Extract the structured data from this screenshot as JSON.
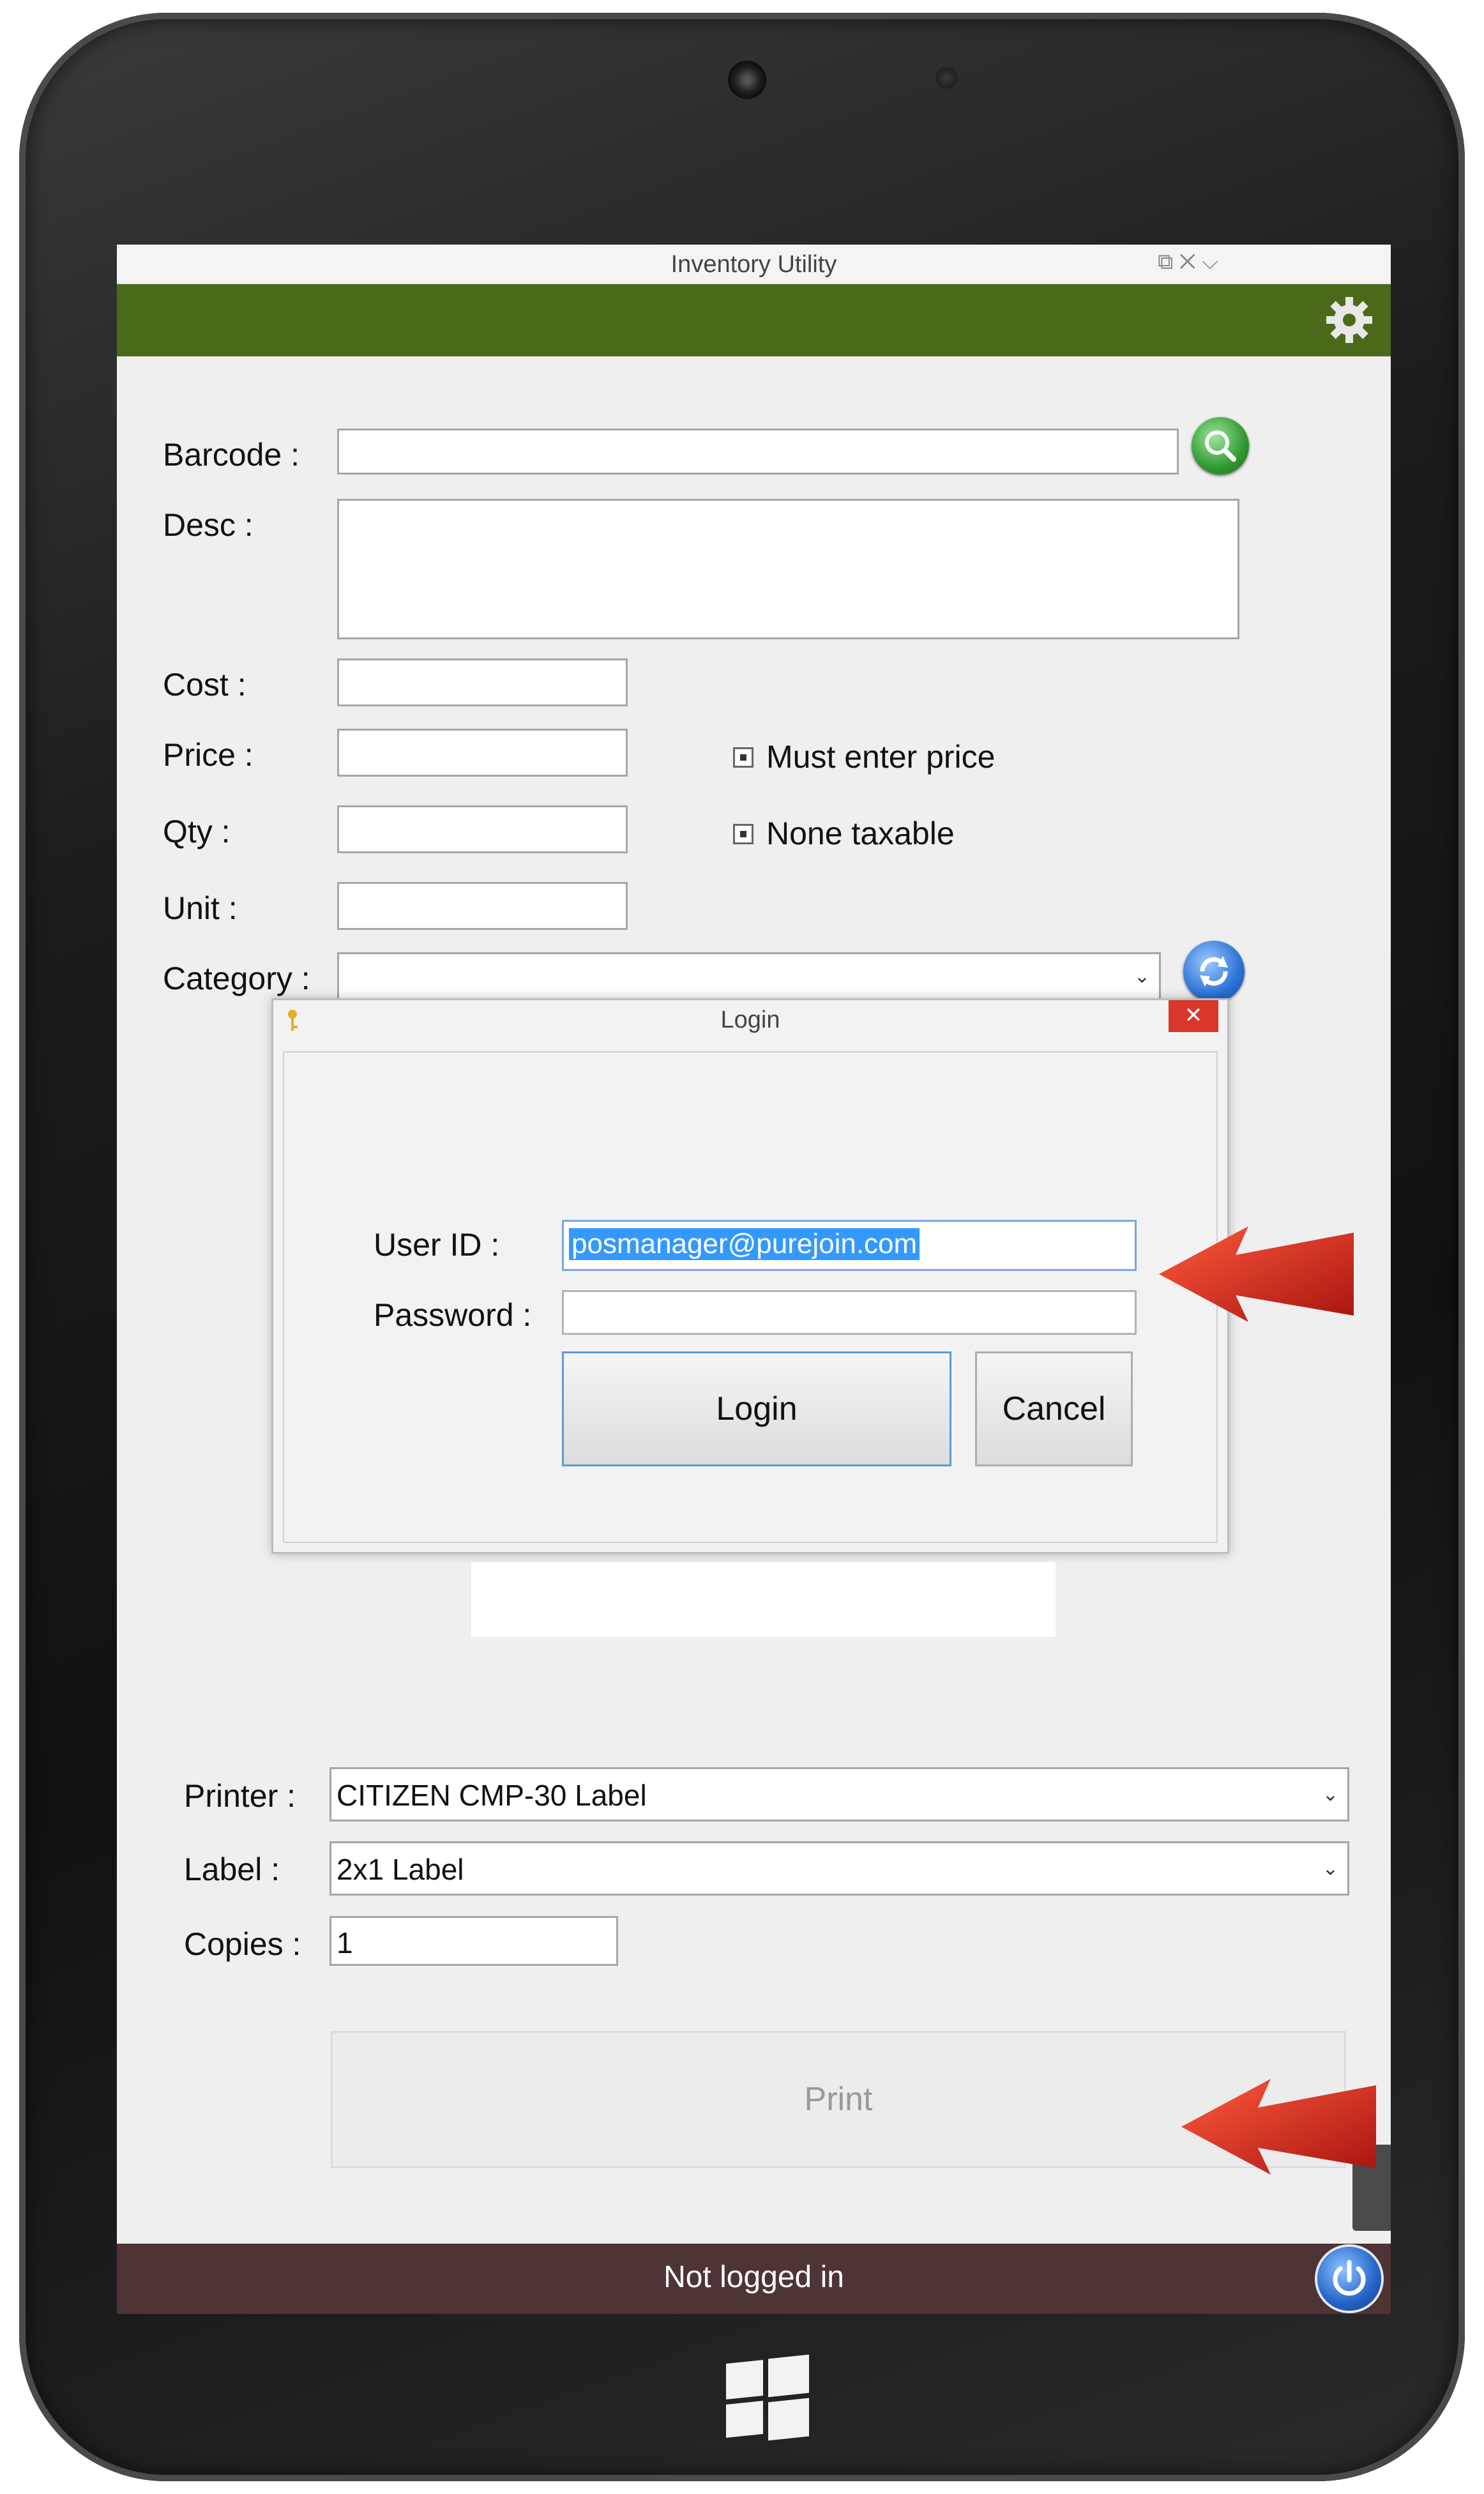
{
  "window": {
    "title": "Inventory Utility",
    "controls": "⧉ ✕ ⌵"
  },
  "form": {
    "barcode_label": "Barcode :",
    "desc_label": "Desc :",
    "cost_label": "Cost :",
    "price_label": "Price :",
    "qty_label": "Qty :",
    "unit_label": "Unit :",
    "category_label": "Category :",
    "must_enter_price_label": "Must enter price",
    "none_taxable_label": "None taxable",
    "printer_label": "Printer :",
    "printer_value": "CITIZEN CMP-30 Label",
    "label_label": "Label :",
    "label_value": "2x1 Label",
    "copies_label": "Copies :",
    "copies_value": "1",
    "print_button": "Print"
  },
  "login_dialog": {
    "title": "Login",
    "close": "✕",
    "user_id_label": "User ID :",
    "user_id_value": "posmanager@purejoin.com",
    "password_label": "Password :",
    "login_button": "Login",
    "cancel_button": "Cancel"
  },
  "status": {
    "text": "Not logged in"
  },
  "icons": {
    "settings": "gear-icon",
    "search": "search-icon",
    "refresh": "refresh-icon",
    "power": "power-icon",
    "key": "key-icon",
    "windows": "windows-logo-icon"
  },
  "colors": {
    "header_green": "#4a6a1a",
    "status_bar": "#4e3434",
    "annotation_arrow": "#d42a1e",
    "selection_blue": "#3399ff"
  }
}
